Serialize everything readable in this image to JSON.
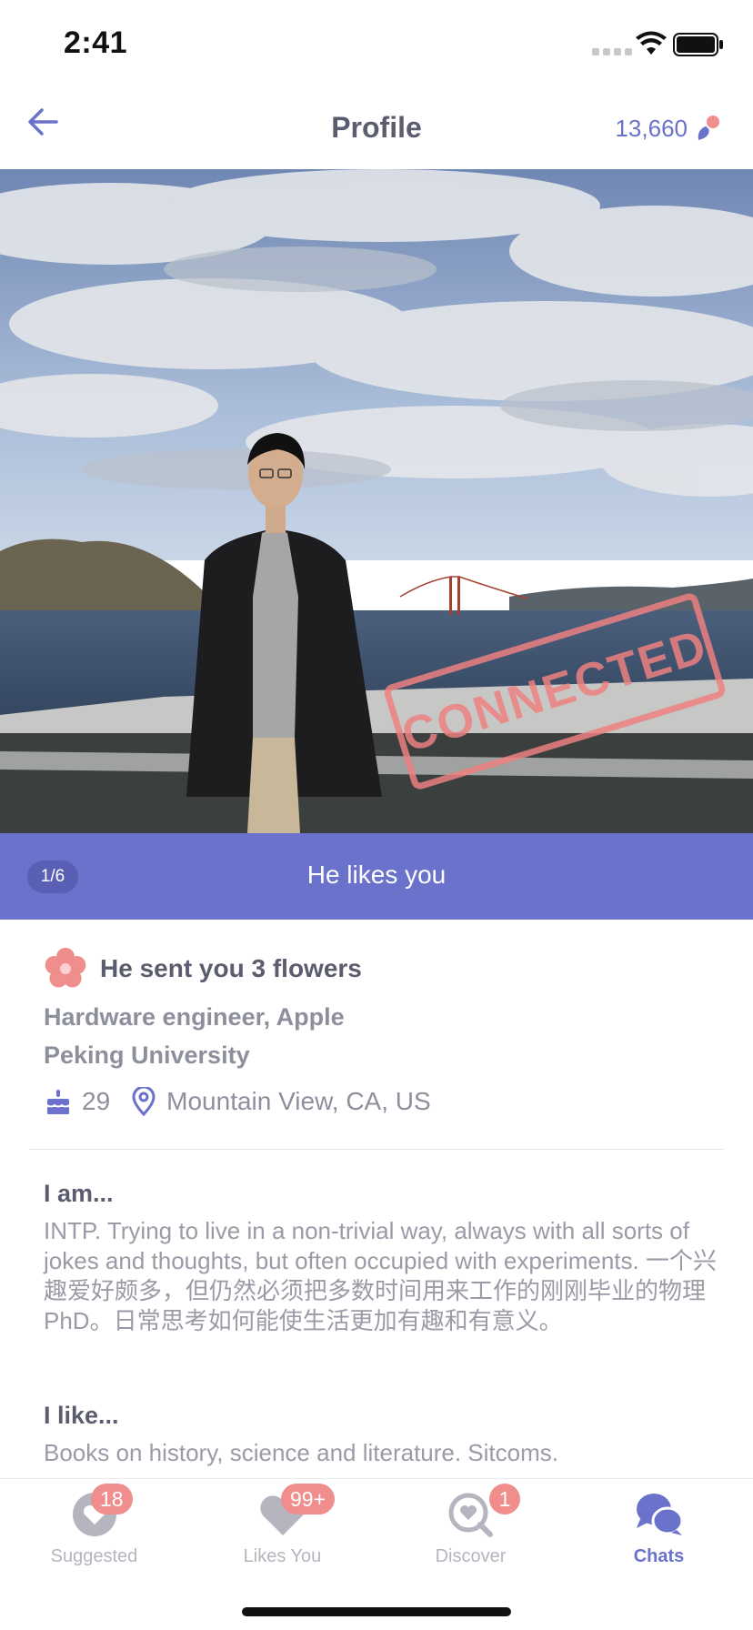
{
  "status_bar": {
    "time": "2:41"
  },
  "nav": {
    "title": "Profile",
    "coins": "13,660"
  },
  "photo": {
    "stamp": "CONNECTED",
    "page_indicator": "1/6",
    "banner": "He likes you"
  },
  "profile": {
    "flowers": "He sent you 3 flowers",
    "job": "Hardware engineer, Apple",
    "school": "Peking University",
    "age": "29",
    "location": "Mountain View, CA, US",
    "sections": [
      {
        "title": "I am...",
        "body": "INTP. Trying to live in a non-trivial way, always with all sorts of jokes and thoughts, but often occupied with experiments. 一个兴趣爱好颇多，但仍然必须把多数时间用来工作的刚刚毕业的物理PhD。日常思考如何能使生活更加有趣和有意义。"
      },
      {
        "title": "I like...",
        "body": "Books on history, science and literature. Sitcoms."
      }
    ]
  },
  "tabs": [
    {
      "label": "Suggested",
      "badge": "18",
      "icon": "heart-badge-icon"
    },
    {
      "label": "Likes You",
      "badge": "99+",
      "icon": "heart-icon"
    },
    {
      "label": "Discover",
      "badge": "1",
      "icon": "search-heart-icon"
    },
    {
      "label": "Chats",
      "badge": "",
      "icon": "chat-bubbles-icon"
    }
  ],
  "colors": {
    "accent": "#6a72cc",
    "badge": "#f08d8d",
    "stamp": "#ec8080"
  }
}
